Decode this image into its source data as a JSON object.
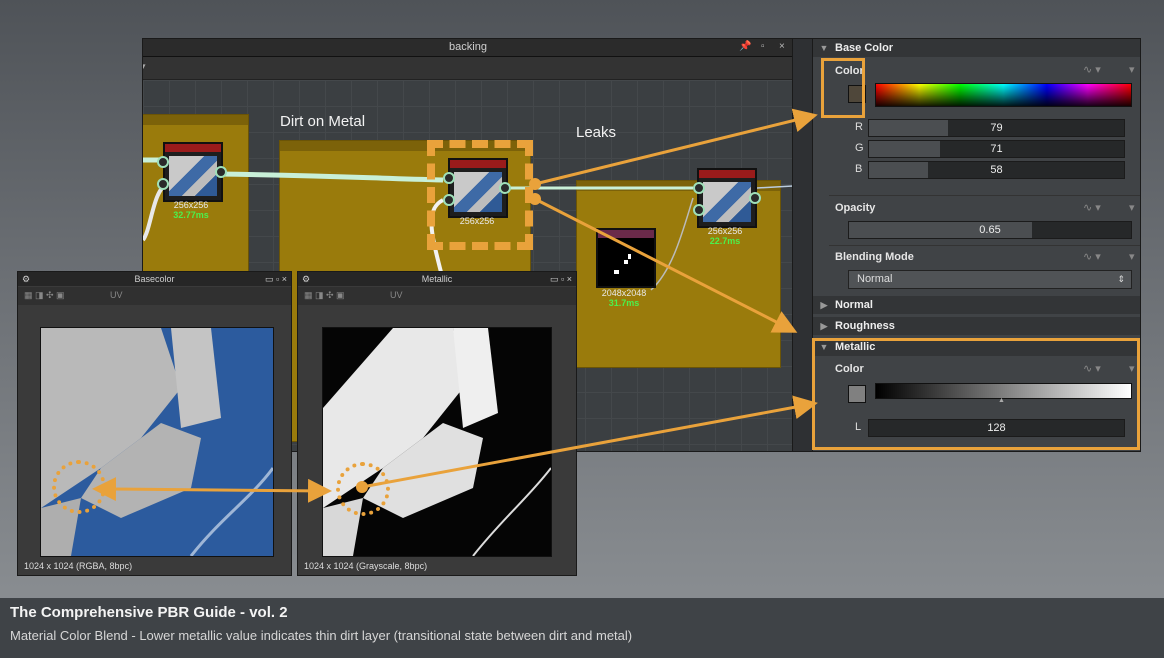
{
  "graph": {
    "title": "backing",
    "frame_dirt": "Dirt on Metal",
    "frame_leaks": "Leaks",
    "node1": {
      "res": "256x256",
      "ms": "32.77ms"
    },
    "node2": {
      "res": "256x256",
      "ms": ""
    },
    "node3": {
      "res": "256x256",
      "ms": "22.7ms"
    },
    "node4": {
      "res": "2048x2048",
      "ms": "31.7ms"
    }
  },
  "props": {
    "base_color": {
      "header": "Base Color",
      "color_label": "Color",
      "swatch": "#4f473a",
      "channels": [
        {
          "label": "R",
          "value": "79",
          "fraction": 0.31
        },
        {
          "label": "G",
          "value": "71",
          "fraction": 0.28
        },
        {
          "label": "B",
          "value": "58",
          "fraction": 0.23
        }
      ]
    },
    "opacity": {
      "label": "Opacity",
      "value": "0.65",
      "fraction": 0.65
    },
    "blending": {
      "label": "Blending Mode",
      "value": "Normal"
    },
    "normal": "Normal",
    "roughness": "Roughness",
    "metallic": {
      "header": "Metallic",
      "color_label": "Color",
      "swatch": "#808080",
      "l_label": "L",
      "l_value": "128",
      "l_fraction": 0.5
    }
  },
  "viewers": {
    "basecolor": {
      "title": "Basecolor",
      "uv": "UV",
      "status": "1024 x 1024 (RGBA, 8bpc)"
    },
    "metallic": {
      "title": "Metallic",
      "uv": "UV",
      "status": "1024 x 1024 (Grayscale, 8bpc)"
    }
  },
  "caption": {
    "title": "The Comprehensive PBR Guide - vol. 2",
    "subtitle": "Material Color Blend - Lower metallic value indicates thin dirt layer (transitional state between dirt and metal)"
  },
  "colors": {
    "accent": "#e9a23b",
    "frame": "#9a7b0c",
    "ms_green": "#4cf04c"
  }
}
